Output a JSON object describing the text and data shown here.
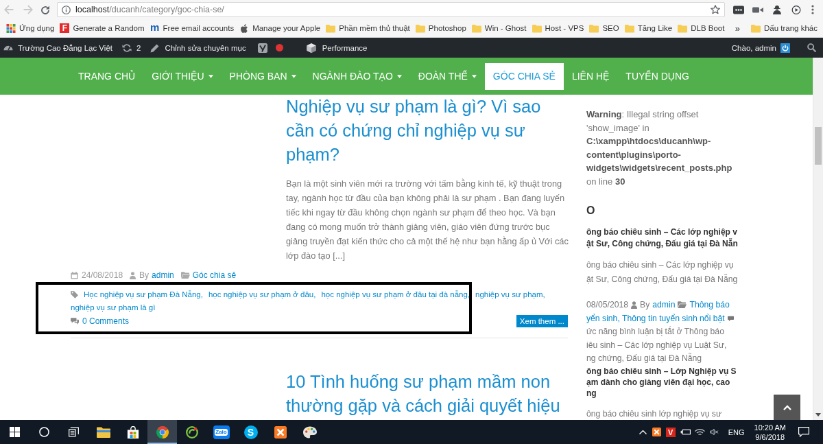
{
  "browser": {
    "nav": {
      "back_disabled": true,
      "forward_disabled": true
    },
    "url": {
      "host": "localhost",
      "path": "/ducanh/category/goc-chia-se/"
    },
    "extensions": [
      {
        "kind": "dots"
      },
      {
        "kind": "camera"
      },
      {
        "kind": "person"
      },
      {
        "kind": "play"
      }
    ],
    "bookmarks": [
      {
        "kind": "apps",
        "label": "Ứng dụng"
      },
      {
        "kind": "tile",
        "icon_text": "F",
        "label": "Generate a Random"
      },
      {
        "kind": "glyph",
        "icon_text": "m",
        "label": "Free email accounts"
      },
      {
        "kind": "apple",
        "label": "Manage your Apple"
      },
      {
        "kind": "folder",
        "label": "Phần mềm thủ thuật"
      },
      {
        "kind": "folder",
        "label": "Photoshop"
      },
      {
        "kind": "folder",
        "label": "Win - Ghost"
      },
      {
        "kind": "folder",
        "label": "Host - VPS"
      },
      {
        "kind": "folder",
        "label": "SEO"
      },
      {
        "kind": "folder",
        "label": "Tăng Like"
      },
      {
        "kind": "folder",
        "label": "DLB Boot"
      }
    ],
    "overflow": "»",
    "other_bookmarks": "Dấu trang khác"
  },
  "admin_bar": {
    "site_name": "Trường Cao Đẳng Lạc Việt",
    "updates": "2",
    "edit": "Chỉnh sửa chuyên mục",
    "seo_score": {
      "color": "#dd3333"
    },
    "performance": "Performance",
    "greeting": "Chào, admin"
  },
  "menu": [
    {
      "label": "TRANG CHỦ",
      "has_submenu": false,
      "selected": false
    },
    {
      "label": "GIỚI THIỆU",
      "has_submenu": true,
      "selected": false
    },
    {
      "label": "PHÒNG BAN",
      "has_submenu": true,
      "selected": false
    },
    {
      "label": "NGÀNH ĐÀO TẠO",
      "has_submenu": true,
      "selected": false
    },
    {
      "label": "ĐOÀN THỂ",
      "has_submenu": true,
      "selected": false
    },
    {
      "label": "GÓC CHIA SẺ",
      "has_submenu": false,
      "selected": true
    },
    {
      "label": "LIÊN HỆ",
      "has_submenu": false,
      "selected": false
    },
    {
      "label": "TUYỂN DỤNG",
      "has_submenu": false,
      "selected": false
    }
  ],
  "posts": [
    {
      "title": "Nghiệp vụ sư phạm là gì? Vì sao cần có chứng chỉ nghiệp vụ sư phạm?",
      "excerpt": "Bạn là một sinh viên mới ra trường với tấm bằng kinh tế, kỹ thuật trong tay, ngành học từ đầu của bạn không phải là sư phạm . Bạn đang luyến tiếc khi ngay từ đầu không chọn ngành sư phạm để theo học. Và bạn đang có mong muốn trở thành giảng viên, giáo viên đứng trước bục giảng truyền đạt kiến thức cho cả một thế hệ như bạn hằng ấp ủ Với các lớp đào tạo [...]",
      "date": "24/08/2018",
      "by": "By",
      "author": "admin",
      "category": "Góc chia sẻ",
      "tags": [
        "Học nghiệp vụ sư phạm Đà Nẵng,",
        "học nghiệp vụ sư phạm ở đâu,",
        "học nghiệp vụ sư phạm ở đâu tại đà nẵng,",
        "nghiệp vụ sư phạm,",
        "nghiệp vụ sư phạm là gì"
      ],
      "comments": "0 Comments",
      "read_more": "Xem them ..."
    },
    {
      "title": "10 Tình huống sư phạm mầm non thường gặp và cách giải quyết hiệu"
    }
  ],
  "sidebar": {
    "warning": "**Warning**: Illegal string offset 'show_image' in **C:\\xampp\\htdocs\\ducanh\\wp-content\\plugins\\porto-widgets\\widgets\\recent_posts.php** on line **30**",
    "widget_title": "O",
    "recent_posts": [
      {
        "title_lines": [
          "ông báo chiêu sinh – Các lớp nghiệp v",
          "ật Sư, Công chứng, Đấu giá tại Đà Nẵn"
        ],
        "excerpt_lines": [
          "ông báo chiêu sinh – Các lớp nghiệp vụ",
          "ật Sư, Công chứng, Đấu giá tại Đà Nẵng"
        ],
        "date": "08/05/2018",
        "by": "By",
        "author": "admin",
        "category_lines": [
          "Thông báo",
          "yển sinh, Thông tin tuyển sinh nổi bật"
        ],
        "comments_lines": [
          "ức năng bình luận bị tắt ở Thông báo",
          "iêu sinh – Các lớp nghiệp vụ Luật Sư,",
          "ng chứng, Đấu giá tại Đà Nẵng"
        ]
      },
      {
        "title_lines": [
          "ông báo chiêu sinh – Lớp Nghiệp vụ S",
          "ạm dành cho giảng viên đại học, cao",
          "ng"
        ],
        "excerpt_lines": [
          "ông báo chiêu sinh lớp nghiệp vụ sư"
        ]
      }
    ]
  },
  "taskbar": {
    "apps": [
      {
        "kind": "start",
        "selected": false
      },
      {
        "kind": "search",
        "selected": false
      },
      {
        "kind": "task_view",
        "selected": false
      },
      {
        "kind": "explorer",
        "selected": false
      },
      {
        "kind": "store",
        "selected": false
      },
      {
        "kind": "chrome",
        "selected": true
      },
      {
        "kind": "coccoc",
        "selected": false
      },
      {
        "kind": "zalo",
        "icon_text": "Zalo",
        "selected": false
      },
      {
        "kind": "skype",
        "icon_text": "S",
        "selected": false
      },
      {
        "kind": "xampp",
        "selected": false
      },
      {
        "kind": "paint",
        "selected": false
      }
    ],
    "tray": [
      {
        "kind": "chevron"
      },
      {
        "kind": "xampp"
      },
      {
        "kind": "letter",
        "icon_text": "V"
      },
      {
        "kind": "battery"
      },
      {
        "kind": "wifi"
      },
      {
        "kind": "volume",
        "muted": true
      }
    ],
    "language": "ENG",
    "time": "10:20 AM",
    "date": "9/6/2018"
  }
}
